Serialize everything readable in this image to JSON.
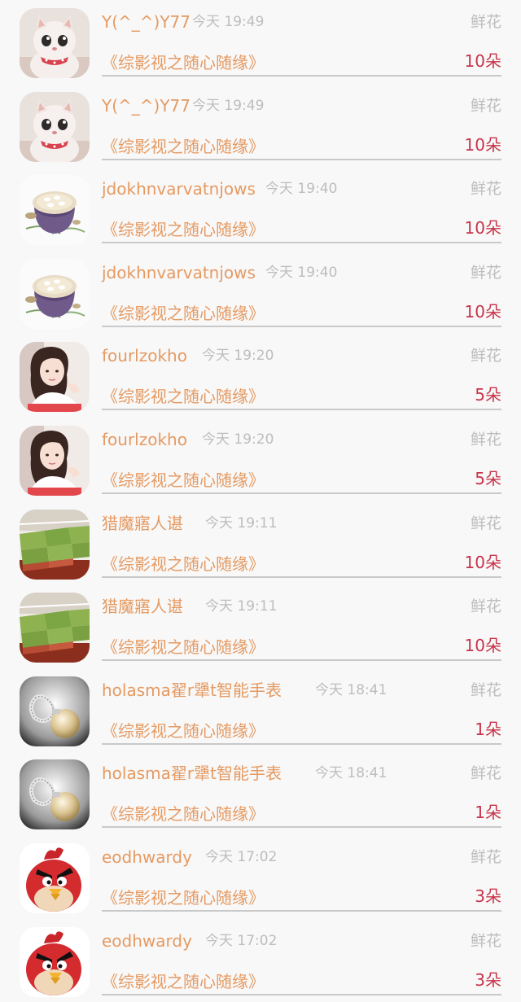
{
  "items": [
    {
      "username": "Y(^_^)Y77",
      "time": "今天 19:49",
      "gift_type": "鲜花",
      "show_title": "《综影视之随心随缘》",
      "gift_count": "10朵",
      "avatar": "cat-avatar"
    },
    {
      "username": "Y(^_^)Y77",
      "time": "今天 19:49",
      "gift_type": "鲜花",
      "show_title": "《综影视之随心随缘》",
      "gift_count": "10朵",
      "avatar": "cat-avatar"
    },
    {
      "username": "jdokhnvarvatnjows",
      "time": "今天 19:40",
      "gift_type": "鲜花",
      "show_title": "《综影视之随心随缘》",
      "gift_count": "10朵",
      "avatar": "bowl-avatar"
    },
    {
      "username": "jdokhnvarvatnjows",
      "time": "今天 19:40",
      "gift_type": "鲜花",
      "show_title": "《综影视之随心随缘》",
      "gift_count": "10朵",
      "avatar": "bowl-avatar"
    },
    {
      "username": "fourlzokho",
      "time": "今天 19:20",
      "gift_type": "鲜花",
      "show_title": "《综影视之随心随缘》",
      "gift_count": "5朵",
      "avatar": "girl-avatar"
    },
    {
      "username": "fourlzokho",
      "time": "今天 19:20",
      "gift_type": "鲜花",
      "show_title": "《综影视之随心随缘》",
      "gift_count": "5朵",
      "avatar": "girl-avatar"
    },
    {
      "username": "猎魔寤人谌",
      "time": "今天 19:11",
      "gift_type": "鲜花",
      "show_title": "《综影视之随心随缘》",
      "gift_count": "10朵",
      "avatar": "matcha-cake-avatar"
    },
    {
      "username": "猎魔寤人谌",
      "time": "今天 19:11",
      "gift_type": "鲜花",
      "show_title": "《综影视之随心随缘》",
      "gift_count": "10朵",
      "avatar": "matcha-cake-avatar"
    },
    {
      "username": "holasma翟r犟t智能手表",
      "time": "今天 18:41",
      "gift_type": "鲜花",
      "show_title": "《综影视之随心随缘》",
      "gift_count": "1朵",
      "avatar": "pearl-earring-avatar"
    },
    {
      "username": "holasma翟r犟t智能手表",
      "time": "今天 18:41",
      "gift_type": "鲜花",
      "show_title": "《综影视之随心随缘》",
      "gift_count": "1朵",
      "avatar": "pearl-earring-avatar"
    },
    {
      "username": "eodhwardy",
      "time": "今天 17:02",
      "gift_type": "鲜花",
      "show_title": "《综影视之随心随缘》",
      "gift_count": "3朵",
      "avatar": "red-bird-avatar"
    },
    {
      "username": "eodhwardy",
      "time": "今天 17:02",
      "gift_type": "鲜花",
      "show_title": "《综影视之随心随缘》",
      "gift_count": "3朵",
      "avatar": "red-bird-avatar"
    }
  ],
  "colors": {
    "accent": "#e59a62",
    "count": "#c8334a",
    "muted": "#bdbdbd",
    "background": "#f8f8f8"
  }
}
